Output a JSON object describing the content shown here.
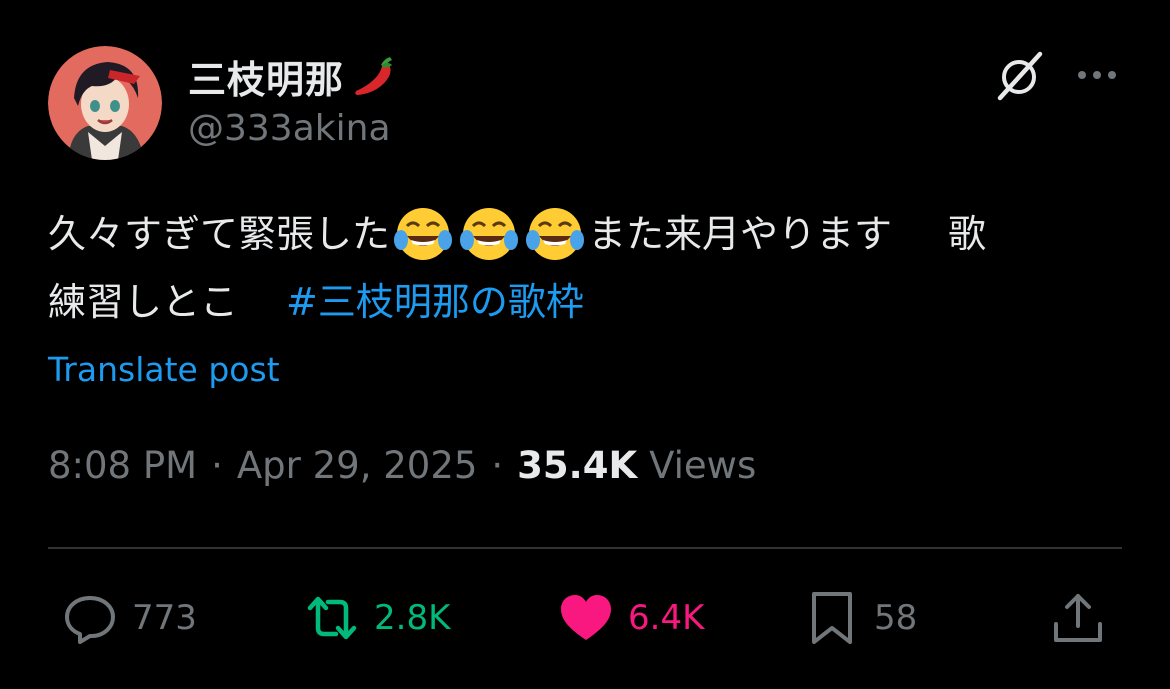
{
  "author": {
    "display_name": "三枝明那",
    "handle": "@333akina",
    "avatar_icon": "avatar-image",
    "name_emoji": "hot-pepper-icon"
  },
  "header": {
    "grok_icon": "grok-icon",
    "more_icon": "more-icon"
  },
  "post": {
    "line1_text_a": "久々すぎて緊張した",
    "line1_emoji": [
      "face-with-tears-of-joy-icon",
      "face-with-tears-of-joy-icon",
      "face-with-tears-of-joy-icon"
    ],
    "line1_text_b": "また来月やります",
    "line1_text_c": "歌",
    "line2_text": "練習しとこ",
    "hashtag": "#三枝明那の歌枠"
  },
  "translate_label": "Translate post",
  "meta": {
    "time": "8:08 PM",
    "separator": "·",
    "date": "Apr 29, 2025",
    "views_count": "35.4K",
    "views_label": "Views"
  },
  "actions": {
    "reply_count": "773",
    "retweet_count": "2.8K",
    "like_count": "6.4K",
    "bookmark_count": "58"
  },
  "colors": {
    "background": "#000000",
    "text": "#e7e9ea",
    "secondary": "#71767b",
    "link": "#1d9bf0",
    "retweet": "#00ba7c",
    "like": "#f91880"
  }
}
